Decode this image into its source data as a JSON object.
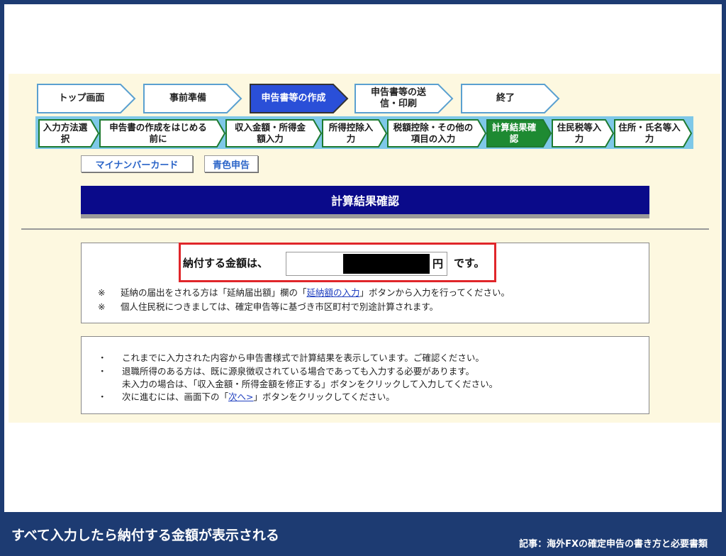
{
  "steps": [
    {
      "label": "トップ画面"
    },
    {
      "label": "事前準備"
    },
    {
      "label": "申告書等の作成"
    },
    {
      "label": "申告書等の送信・印刷"
    },
    {
      "label": "終了"
    }
  ],
  "substeps": [
    {
      "label": "入力方法選択"
    },
    {
      "label": "申告書の作成をはじめる前に"
    },
    {
      "label": "収入金額・所得金額入力"
    },
    {
      "label": "所得控除入力"
    },
    {
      "label": "税額控除・その他の項目の入力"
    },
    {
      "label": "計算結果確認"
    },
    {
      "label": "住民税等入力"
    },
    {
      "label": "住所・氏名等入力"
    }
  ],
  "tags": {
    "mynumber": "マイナンバーカード",
    "aoiro": "青色申告"
  },
  "banner_title": "計算結果確認",
  "payment": {
    "label": "納付する金額は、",
    "unit": "円",
    "suffix": "です。"
  },
  "notes": [
    {
      "mark": "※",
      "before": "延納の届出をされる方は「延納届出額」欄の「",
      "link": "延納額の入力",
      "after": "」ボタンから入力を行ってください。"
    },
    {
      "mark": "※",
      "text": "個人住民税につきましては、確定申告等に基づき市区町村で別途計算されます。"
    }
  ],
  "bullets": [
    {
      "mark": "・",
      "text": "これまでに入力された内容から申告書様式で計算結果を表示しています。ご確認ください。"
    },
    {
      "mark": "・",
      "text": "退職所得のある方は、既に源泉徴収されている場合であっても入力する必要があります。"
    },
    {
      "mark": "",
      "text": "未入力の場合は、「収入金額・所得金額を修正する」ボタンをクリックして入力してください。"
    },
    {
      "mark": "・",
      "before": "次に進むには、画面下の「",
      "link": "次へ>",
      "after": "」ボタンをクリックしてください。"
    }
  ],
  "footer": {
    "caption": "すべて入力したら納付する金額が表示される",
    "article": "記事：海外FXの確定申告の書き方と必要書類"
  },
  "colors": {
    "navy": "#1d3b72",
    "active_step": "#2a4fd8",
    "active_substep": "#1e8a32",
    "highlight": "#e0262a"
  }
}
